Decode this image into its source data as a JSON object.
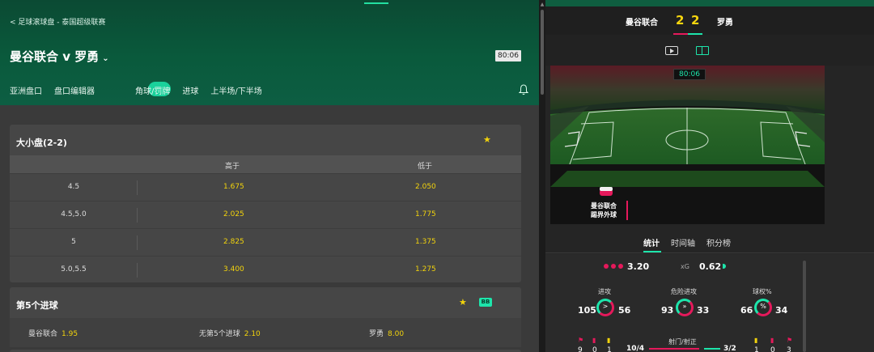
{
  "breadcrumb": "< 足球滚球盘 - 泰国超级联赛",
  "match": {
    "title": "曼谷联合 v 罗勇",
    "clock": "80:06"
  },
  "tabs": [
    "亚洲盘口",
    "盘口编辑器",
    "角球/罚牌",
    "进球",
    "上半场/下半场"
  ],
  "markets": {
    "totals": {
      "title": "大小盘(2-2)",
      "over_label": "高于",
      "under_label": "低于",
      "rows": [
        {
          "line": "4.5",
          "over": "1.675",
          "under": "2.050"
        },
        {
          "line": "4.5,5.0",
          "over": "2.025",
          "under": "1.775"
        },
        {
          "line": "5",
          "over": "2.825",
          "under": "1.375"
        },
        {
          "line": "5.0,5.5",
          "over": "3.400",
          "under": "1.275"
        }
      ]
    },
    "fifth_goal": {
      "title": "第5个进球",
      "badge": "BB",
      "options": [
        {
          "label": "曼谷联合",
          "odds": "1.95"
        },
        {
          "label": "无第5个进球",
          "odds": "2.10"
        },
        {
          "label": "罗勇",
          "odds": "8.00"
        }
      ]
    }
  },
  "scoreboard": {
    "home": "曼谷联合",
    "away": "罗勇",
    "home_score": "2",
    "away_score": "2"
  },
  "pitch": {
    "clock": "80:06",
    "event_team": "曼谷联合",
    "event_desc": "踢界外球"
  },
  "stats_tabs": [
    "统计",
    "时间轴",
    "积分榜"
  ],
  "stats": {
    "xg_home": "3.20",
    "xg_label": "xG",
    "xg_away": "0.62",
    "items": [
      {
        "label": "进攻",
        "home": "105",
        "away": "56",
        "symbol": ">"
      },
      {
        "label": "危险进攻",
        "home": "93",
        "away": "33",
        "symbol": "»"
      },
      {
        "label": "球权%",
        "home": "66",
        "away": "34",
        "symbol": "%"
      }
    ],
    "shots_label": "射门/射正",
    "shots_home": "10/4",
    "shots_away": "3/2",
    "home_cards": [
      "9",
      "0",
      "1"
    ],
    "away_cards": [
      "1",
      "0",
      "3"
    ]
  },
  "colors": {
    "accent": "#1de5ab",
    "odds": "#f2d30c",
    "home": "#e5195b",
    "header_green": "#0a5a3c"
  }
}
